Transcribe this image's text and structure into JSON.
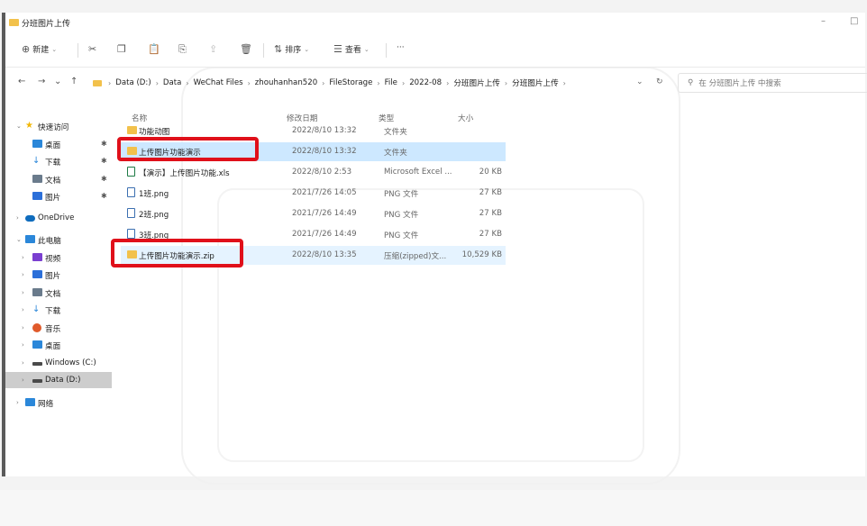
{
  "window": {
    "title": "分班图片上传",
    "minimize": "–",
    "maximize": "□"
  },
  "toolbar": {
    "new_label": "新建",
    "sort_label": "排序",
    "view_label": "查看",
    "more_label": "···"
  },
  "address": {
    "back": "←",
    "forward": "→",
    "recent": "⌄",
    "up": "↑",
    "breadcrumbs": [
      "Data (D:)",
      "Data",
      "WeChat Files",
      "zhouhanhan520",
      "FileStorage",
      "File",
      "2022-08",
      "分班图片上传",
      "分班图片上传"
    ],
    "refresh": "↻",
    "dropdown": "⌄",
    "search_placeholder": "在 分班图片上传 中搜索"
  },
  "sidebar": {
    "items": [
      {
        "label": "快速访问",
        "icon": "star-icon",
        "color": "#f2b705"
      },
      {
        "label": "桌面",
        "icon": "desktop-icon",
        "color": "#2b87d9"
      },
      {
        "label": "下载",
        "icon": "download-icon",
        "color": "#2b87d9"
      },
      {
        "label": "文档",
        "icon": "document-icon",
        "color": "#6a7b8c"
      },
      {
        "label": "图片",
        "icon": "pictures-icon",
        "color": "#2b6fd9"
      },
      {
        "label": "OneDrive",
        "icon": "cloud-icon",
        "color": "#0f6cbd"
      },
      {
        "label": "此电脑",
        "icon": "computer-icon",
        "color": "#2b87d9"
      },
      {
        "label": "视频",
        "icon": "video-icon",
        "color": "#7a3fd0"
      },
      {
        "label": "图片",
        "icon": "pictures-icon",
        "color": "#2b6fd9"
      },
      {
        "label": "文档",
        "icon": "document-icon",
        "color": "#6a7b8c"
      },
      {
        "label": "下载",
        "icon": "download-icon",
        "color": "#2b87d9"
      },
      {
        "label": "音乐",
        "icon": "music-icon",
        "color": "#e05a2b"
      },
      {
        "label": "桌面",
        "icon": "desktop-icon",
        "color": "#2b87d9"
      },
      {
        "label": "Windows (C:)",
        "icon": "drive-icon",
        "color": "#4a4a4a"
      },
      {
        "label": "Data (D:)",
        "icon": "drive-icon",
        "color": "#4a4a4a"
      },
      {
        "label": "网络",
        "icon": "network-icon",
        "color": "#2b87d9"
      }
    ]
  },
  "columns": {
    "name": "名称",
    "date": "修改日期",
    "type": "类型",
    "size": "大小"
  },
  "files": [
    {
      "name": "功能动图",
      "date": "2022/8/10 13:32",
      "type": "文件夹",
      "size": "",
      "icon": "folder-icon",
      "icon_color": "#f2c14b"
    },
    {
      "name": "上传图片功能演示",
      "date": "2022/8/10 13:32",
      "type": "文件夹",
      "size": "",
      "icon": "folder-icon",
      "icon_color": "#f2c14b"
    },
    {
      "name": "【演示】上传图片功能.xls",
      "date": "2022/8/10 2:53",
      "type": "Microsoft Excel ...",
      "size": "20 KB",
      "icon": "excel-icon",
      "icon_color": "#1d7a45"
    },
    {
      "name": "1班.png",
      "date": "2021/7/26 14:05",
      "type": "PNG 文件",
      "size": "27 KB",
      "icon": "image-file-icon",
      "icon_color": "#3b6fb0"
    },
    {
      "name": "2班.png",
      "date": "2021/7/26 14:49",
      "type": "PNG 文件",
      "size": "27 KB",
      "icon": "image-file-icon",
      "icon_color": "#3b6fb0"
    },
    {
      "name": "3班.png",
      "date": "2021/7/26 14:49",
      "type": "PNG 文件",
      "size": "27 KB",
      "icon": "image-file-icon",
      "icon_color": "#3b6fb0"
    },
    {
      "name": "上传图片功能演示.zip",
      "date": "2022/8/10 13:35",
      "type": "压缩(zipped)文...",
      "size": "10,529 KB",
      "icon": "zip-folder-icon",
      "icon_color": "#f2c14b"
    }
  ]
}
